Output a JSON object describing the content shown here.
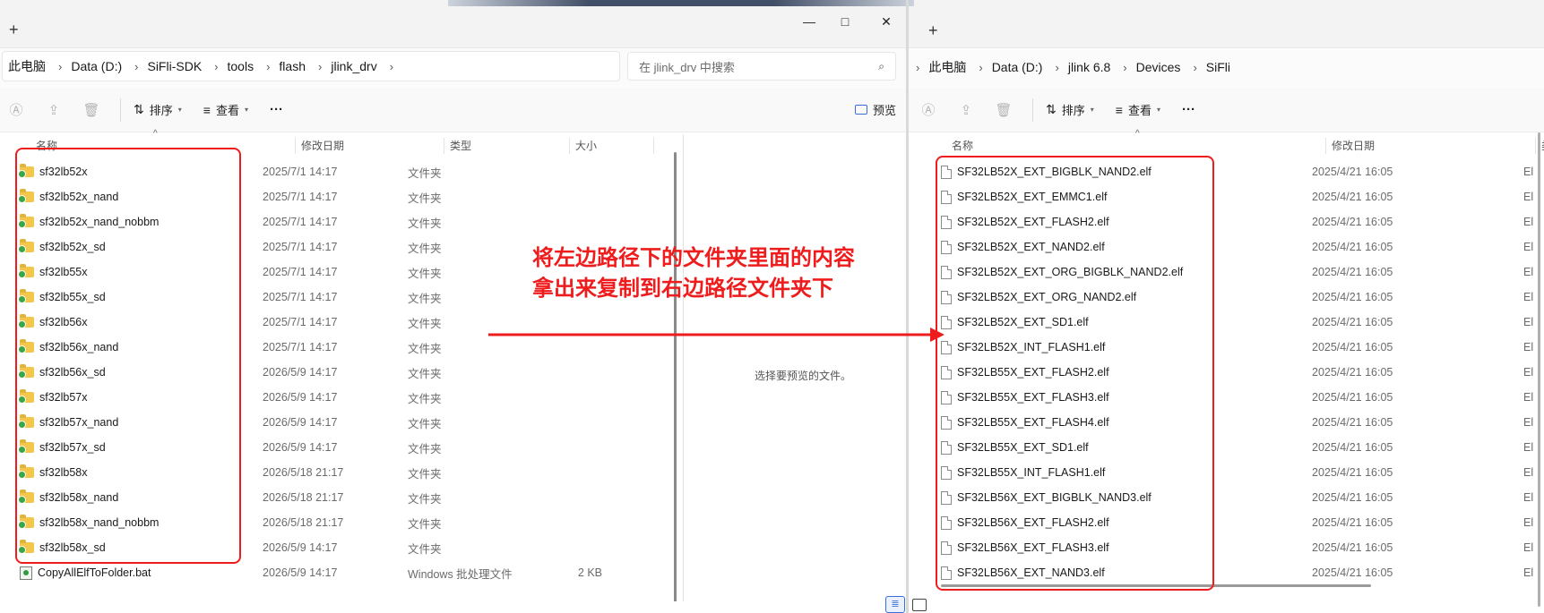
{
  "left_window": {
    "new_tab_symbol": "+",
    "window_controls": [
      "—",
      "□",
      "✕"
    ],
    "breadcrumb": [
      "此电脑",
      "Data (D:)",
      "SiFli-SDK",
      "tools",
      "flash",
      "jlink_drv"
    ],
    "search_placeholder": "在 jlink_drv 中搜索",
    "toolbar": {
      "sort_label": "排序",
      "view_label": "查看",
      "more_label": "···",
      "preview_label": "预览"
    },
    "columns": {
      "name": "名称",
      "date": "修改日期",
      "type": "类型",
      "size": "大小"
    },
    "rows": [
      {
        "name": "sf32lb52x",
        "date": "2025/7/1 14:17",
        "type": "文件夹",
        "size": "",
        "icon": "folder-icon"
      },
      {
        "name": "sf32lb52x_nand",
        "date": "2025/7/1 14:17",
        "type": "文件夹",
        "size": "",
        "icon": "folder-icon"
      },
      {
        "name": "sf32lb52x_nand_nobbm",
        "date": "2025/7/1 14:17",
        "type": "文件夹",
        "size": "",
        "icon": "folder-icon"
      },
      {
        "name": "sf32lb52x_sd",
        "date": "2025/7/1 14:17",
        "type": "文件夹",
        "size": "",
        "icon": "folder-icon"
      },
      {
        "name": "sf32lb55x",
        "date": "2025/7/1 14:17",
        "type": "文件夹",
        "size": "",
        "icon": "folder-icon"
      },
      {
        "name": "sf32lb55x_sd",
        "date": "2025/7/1 14:17",
        "type": "文件夹",
        "size": "",
        "icon": "folder-icon"
      },
      {
        "name": "sf32lb56x",
        "date": "2025/7/1 14:17",
        "type": "文件夹",
        "size": "",
        "icon": "folder-icon"
      },
      {
        "name": "sf32lb56x_nand",
        "date": "2025/7/1 14:17",
        "type": "文件夹",
        "size": "",
        "icon": "folder-icon"
      },
      {
        "name": "sf32lb56x_sd",
        "date": "2026/5/9 14:17",
        "type": "文件夹",
        "size": "",
        "icon": "folder-icon"
      },
      {
        "name": "sf32lb57x",
        "date": "2026/5/9 14:17",
        "type": "文件夹",
        "size": "",
        "icon": "folder-icon"
      },
      {
        "name": "sf32lb57x_nand",
        "date": "2026/5/9 14:17",
        "type": "文件夹",
        "size": "",
        "icon": "folder-icon"
      },
      {
        "name": "sf32lb57x_sd",
        "date": "2026/5/9 14:17",
        "type": "文件夹",
        "size": "",
        "icon": "folder-icon"
      },
      {
        "name": "sf32lb58x",
        "date": "2026/5/18 21:17",
        "type": "文件夹",
        "size": "",
        "icon": "folder-icon"
      },
      {
        "name": "sf32lb58x_nand",
        "date": "2026/5/18 21:17",
        "type": "文件夹",
        "size": "",
        "icon": "folder-icon"
      },
      {
        "name": "sf32lb58x_nand_nobbm",
        "date": "2026/5/18 21:17",
        "type": "文件夹",
        "size": "",
        "icon": "folder-icon"
      },
      {
        "name": "sf32lb58x_sd",
        "date": "2026/5/9 14:17",
        "type": "文件夹",
        "size": "",
        "icon": "folder-icon"
      },
      {
        "name": "CopyAllElfToFolder.bat",
        "date": "2026/5/9 14:17",
        "type": "Windows 批处理文件",
        "size": "2 KB",
        "icon": "bat-file-icon"
      }
    ],
    "preview_text": "选择要预览的文件。"
  },
  "right_window": {
    "new_tab_symbol": "+",
    "breadcrumb": [
      "此电脑",
      "Data (D:)",
      "jlink 6.8",
      "Devices",
      "SiFli"
    ],
    "toolbar": {
      "sort_label": "排序",
      "view_label": "查看",
      "more_label": "···"
    },
    "columns": {
      "name": "名称",
      "date": "修改日期",
      "type": "类"
    },
    "rows": [
      {
        "name": "SF32LB52X_EXT_BIGBLK_NAND2.elf",
        "date": "2025/4/21 16:05",
        "type": "El"
      },
      {
        "name": "SF32LB52X_EXT_EMMC1.elf",
        "date": "2025/4/21 16:05",
        "type": "El"
      },
      {
        "name": "SF32LB52X_EXT_FLASH2.elf",
        "date": "2025/4/21 16:05",
        "type": "El"
      },
      {
        "name": "SF32LB52X_EXT_NAND2.elf",
        "date": "2025/4/21 16:05",
        "type": "El"
      },
      {
        "name": "SF32LB52X_EXT_ORG_BIGBLK_NAND2.elf",
        "date": "2025/4/21 16:05",
        "type": "El"
      },
      {
        "name": "SF32LB52X_EXT_ORG_NAND2.elf",
        "date": "2025/4/21 16:05",
        "type": "El"
      },
      {
        "name": "SF32LB52X_EXT_SD1.elf",
        "date": "2025/4/21 16:05",
        "type": "El"
      },
      {
        "name": "SF32LB52X_INT_FLASH1.elf",
        "date": "2025/4/21 16:05",
        "type": "El"
      },
      {
        "name": "SF32LB55X_EXT_FLASH2.elf",
        "date": "2025/4/21 16:05",
        "type": "El"
      },
      {
        "name": "SF32LB55X_EXT_FLASH3.elf",
        "date": "2025/4/21 16:05",
        "type": "El"
      },
      {
        "name": "SF32LB55X_EXT_FLASH4.elf",
        "date": "2025/4/21 16:05",
        "type": "El"
      },
      {
        "name": "SF32LB55X_EXT_SD1.elf",
        "date": "2025/4/21 16:05",
        "type": "El"
      },
      {
        "name": "SF32LB55X_INT_FLASH1.elf",
        "date": "2025/4/21 16:05",
        "type": "El"
      },
      {
        "name": "SF32LB56X_EXT_BIGBLK_NAND3.elf",
        "date": "2025/4/21 16:05",
        "type": "El"
      },
      {
        "name": "SF32LB56X_EXT_FLASH2.elf",
        "date": "2025/4/21 16:05",
        "type": "El"
      },
      {
        "name": "SF32LB56X_EXT_FLASH3.elf",
        "date": "2025/4/21 16:05",
        "type": "El"
      },
      {
        "name": "SF32LB56X_EXT_NAND3.elf",
        "date": "2025/4/21 16:05",
        "type": "El"
      }
    ]
  },
  "annotation": {
    "line1": "将左边路径下的文件夹里面的内容",
    "line2": "拿出来复制到右边路径文件夹下",
    "color": "#ee1c1c"
  }
}
